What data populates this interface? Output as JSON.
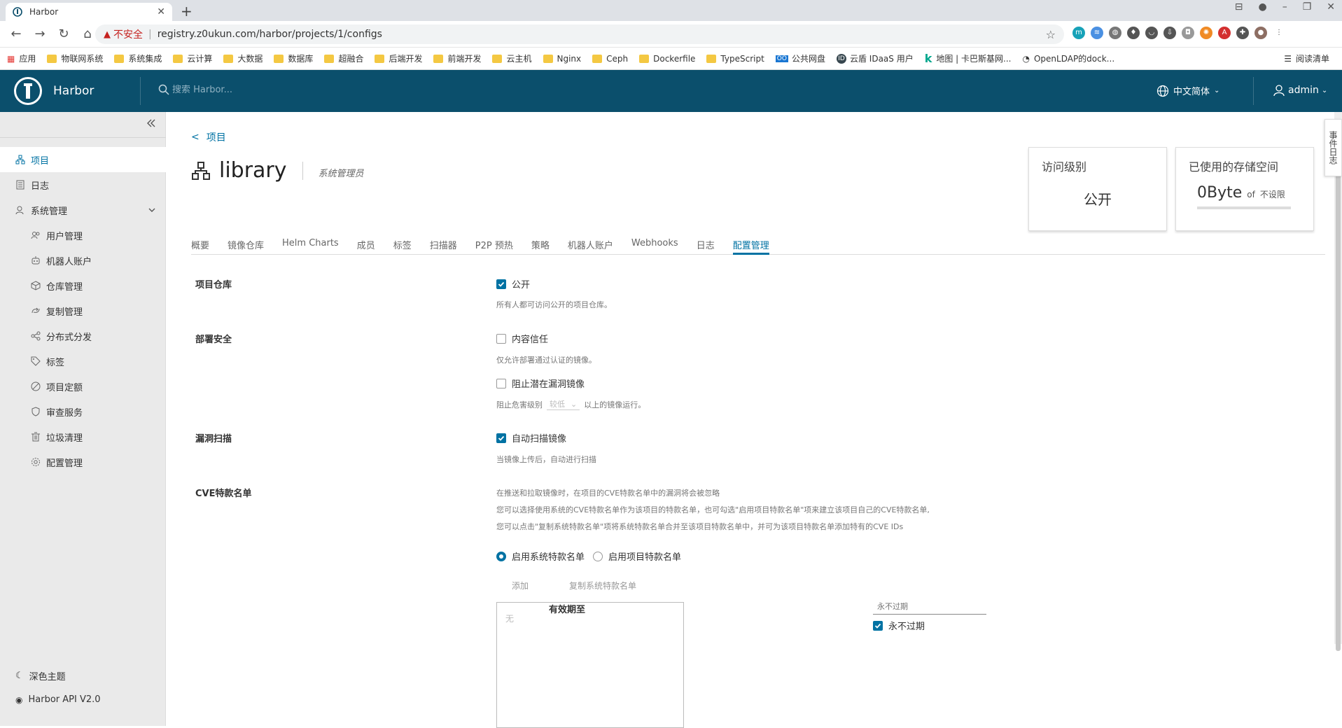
{
  "browser": {
    "tab_title": "Harbor",
    "insecure_label": "不安全",
    "url": "registry.z0ukun.com/harbor/projects/1/configs",
    "bookmarks": [
      "应用",
      "物联网系统",
      "系统集成",
      "云计算",
      "大数据",
      "数据库",
      "超融合",
      "后端开发",
      "前端开发",
      "云主机",
      "Nginx",
      "Ceph",
      "Dockerfile",
      "TypeScript",
      "公共网盘",
      "云盾 IDaaS 用户",
      "地图 | 卡巴斯基网...",
      "OpenLDAP的dock..."
    ],
    "reading_list": "阅读清单"
  },
  "header": {
    "app_name": "Harbor",
    "search_placeholder": "搜索 Harbor...",
    "language": "中文简体",
    "user": "admin"
  },
  "sidebar": {
    "items": [
      {
        "label": "项目",
        "icon": "project-icon"
      },
      {
        "label": "日志",
        "icon": "log-icon"
      },
      {
        "label": "系统管理",
        "icon": "admin-icon"
      }
    ],
    "sub_items": [
      {
        "label": "用户管理",
        "icon": "users-icon"
      },
      {
        "label": "机器人账户",
        "icon": "robot-icon"
      },
      {
        "label": "仓库管理",
        "icon": "registry-icon"
      },
      {
        "label": "复制管理",
        "icon": "replication-icon"
      },
      {
        "label": "分布式分发",
        "icon": "share-icon"
      },
      {
        "label": "标签",
        "icon": "tag-icon"
      },
      {
        "label": "项目定额",
        "icon": "quota-icon"
      },
      {
        "label": "审查服务",
        "icon": "shield-icon"
      },
      {
        "label": "垃圾清理",
        "icon": "trash-icon"
      },
      {
        "label": "配置管理",
        "icon": "gear-icon"
      }
    ],
    "dark_theme": "深色主题",
    "api": "Harbor API V2.0"
  },
  "project": {
    "back_label": "项目",
    "name": "library",
    "role": "系统管理员",
    "access_card": {
      "title": "访问级别",
      "value": "公开"
    },
    "storage_card": {
      "title": "已使用的存储空间",
      "value": "0Byte",
      "of": "of",
      "limit": "不设限"
    }
  },
  "tabs": [
    "概要",
    "镜像仓库",
    "Helm Charts",
    "成员",
    "标签",
    "扫描器",
    "P2P 预热",
    "策略",
    "机器人账户",
    "Webhooks",
    "日志",
    "配置管理"
  ],
  "config": {
    "repo": {
      "label": "项目仓库",
      "checkbox": "公开",
      "hint": "所有人都可访问公开的项目仓库。"
    },
    "deploy": {
      "label": "部署安全",
      "trust": "内容信任",
      "trust_hint": "仅允许部署通过认证的镜像。",
      "block": "阻止潜在漏洞镜像",
      "block_hint_before": "阻止危害级别",
      "block_sev": "较低",
      "block_hint_after": "以上的镜像运行。"
    },
    "scan": {
      "label": "漏洞扫描",
      "checkbox": "自动扫描镜像",
      "hint": "当镜像上传后，自动进行扫描"
    },
    "cve": {
      "label": "CVE特款名单",
      "desc1": "在推送和拉取镜像时，在项目的CVE特款名单中的漏洞将会被忽略",
      "desc2": "您可以选择使用系统的CVE特款名单作为该项目的特款名单，也可勾选\"启用项目特款名单\"项来建立该项目自己的CVE特款名单,",
      "desc3": "您可以点击\"复制系统特款名单\"项将系统特款名单合并至该项目特款名单中，并可为该项目特款名单添加特有的CVE IDs",
      "radio_system": "启用系统特款名单",
      "radio_project": "启用项目特款名单",
      "add": "添加",
      "copy": "复制系统特款名单",
      "empty": "无",
      "expire_label": "有效期至",
      "expire_placeholder": "永不过期",
      "never_expire": "永不过期"
    }
  },
  "event_tab": "事件日志",
  "colors": {
    "header": "#0b4f6c",
    "accent": "#0072a3"
  }
}
